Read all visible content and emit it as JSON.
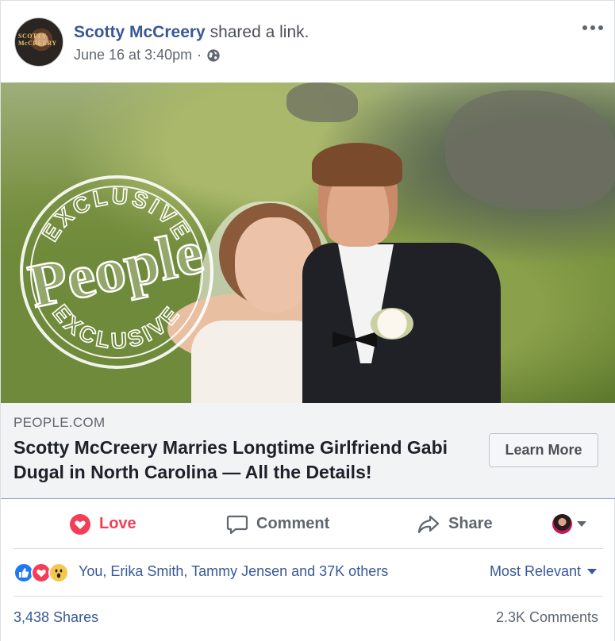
{
  "post": {
    "author_name": "Scotty McCreery",
    "action_text": "shared a link.",
    "timestamp": "June 16 at 3:40pm",
    "separator": "·",
    "avatar_text": "SCOTTY McCREERY"
  },
  "image": {
    "stamp_top_text": "EXCLUSIVE",
    "stamp_bottom_text": "EXCLUSIVE",
    "stamp_logo_text": "People"
  },
  "link_preview": {
    "domain": "PEOPLE.COM",
    "headline": "Scotty McCreery Marries Longtime Girlfriend Gabi Dugal in North Carolina — All the Details!",
    "cta_label": "Learn More"
  },
  "actions": {
    "love_label": "Love",
    "comment_label": "Comment",
    "share_label": "Share"
  },
  "reactions": {
    "summary": "You, Erika Smith, Tammy Jensen and 37K others",
    "sort_label": "Most Relevant",
    "types": [
      "like",
      "love",
      "wow"
    ]
  },
  "stats": {
    "shares": "3,438 Shares",
    "comments": "2.3K Comments"
  },
  "colors": {
    "link_blue": "#385898",
    "love_red": "#f33e58",
    "like_blue": "#2078f4",
    "wow_yellow": "#f7c64d"
  }
}
